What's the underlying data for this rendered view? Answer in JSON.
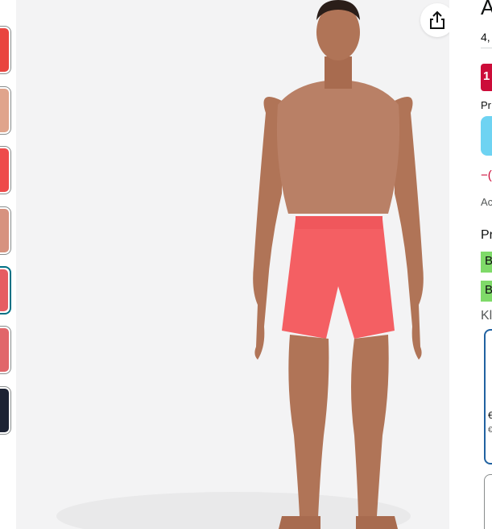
{
  "thumbnails": [
    {
      "name": "thumbnail-1",
      "color": "#e9443f",
      "selected": false
    },
    {
      "name": "thumbnail-2",
      "color": "#e0a48c",
      "selected": false
    },
    {
      "name": "thumbnail-3",
      "color": "#ee4a4a",
      "selected": false
    },
    {
      "name": "thumbnail-4",
      "color": "#d7927f",
      "selected": false
    },
    {
      "name": "thumbnail-5",
      "color": "#e65d62",
      "selected": true
    },
    {
      "name": "thumbnail-6",
      "color": "#e1666a",
      "selected": false
    },
    {
      "name": "thumbnail-7",
      "color": "#1c2233",
      "selected": false
    }
  ],
  "share": {
    "icon": "share-icon"
  },
  "product": {
    "title_partial": "A",
    "rating_partial": "4,",
    "deal_badge_partial": "1",
    "prime_partial": "Pr",
    "discount_partial": "−(",
    "ad_partial": "Ac",
    "promo_heading_partial": "Pr",
    "green_badge_1": "B",
    "green_badge_2": "B",
    "size_label_partial": "Kl",
    "size_card_price_partial": "€",
    "size_card_sub_partial": "€"
  },
  "colors": {
    "accent_red": "#cc0c39",
    "prime_blue": "#6ed3f2",
    "promo_green": "#7fda69",
    "selected_border": "#2162a1",
    "shorts": "#f45f63",
    "skin": "#b07457"
  }
}
